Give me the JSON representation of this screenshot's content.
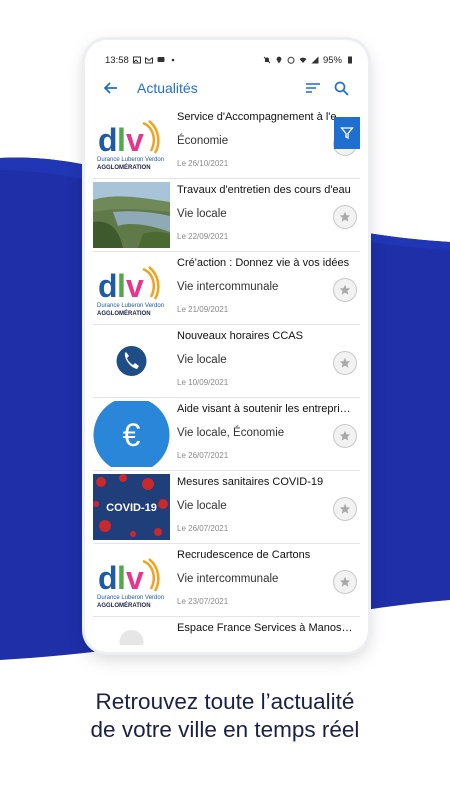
{
  "status_bar": {
    "time": "13:58",
    "battery": "95%"
  },
  "header": {
    "title": "Actualités"
  },
  "news": [
    {
      "title": "Service d'Accompagnement à l'emploi",
      "category": "Économie",
      "date": "Le 26/10/2021",
      "thumb": "dlva-logo"
    },
    {
      "title": "Travaux d'entretien des cours d'eau",
      "category": "Vie locale",
      "date": "Le 22/09/2021",
      "thumb": "river-photo"
    },
    {
      "title": "Cré'action : Donnez vie à vos idées",
      "category": "Vie intercommunale",
      "date": "Le 21/09/2021",
      "thumb": "dlva-logo"
    },
    {
      "title": "Nouveaux horaires CCAS",
      "category": "Vie locale",
      "date": "Le 10/09/2021",
      "thumb": "phone-icon"
    },
    {
      "title": "Aide visant à soutenir les entreprises",
      "category": "Vie locale, Économie",
      "date": "Le 26/07/2021",
      "thumb": "euro-icon"
    },
    {
      "title": "Mesures sanitaires COVID-19",
      "category": "Vie locale",
      "date": "Le 26/07/2021",
      "thumb": "covid-image"
    },
    {
      "title": "Recrudescence de Cartons",
      "category": "Vie intercommunale",
      "date": "Le 23/07/2021",
      "thumb": "dlva-logo"
    },
    {
      "title": "Espace France Services à Manosque",
      "category": "",
      "date": "",
      "thumb": "partial"
    }
  ],
  "dlva_logo": {
    "letters": "dlv",
    "line1": "Durance Luberon Verdon",
    "line2": "AGGLOMÉRATION"
  },
  "covid_label": "COVID-19",
  "euro_symbol": "€",
  "tagline": {
    "line1": "Retrouvez toute l’actualité",
    "line2": "de votre ville en temps réel"
  },
  "colors": {
    "accent": "#1f6fd1",
    "wave": "#1e2fa8",
    "tagline": "#1b2146"
  }
}
